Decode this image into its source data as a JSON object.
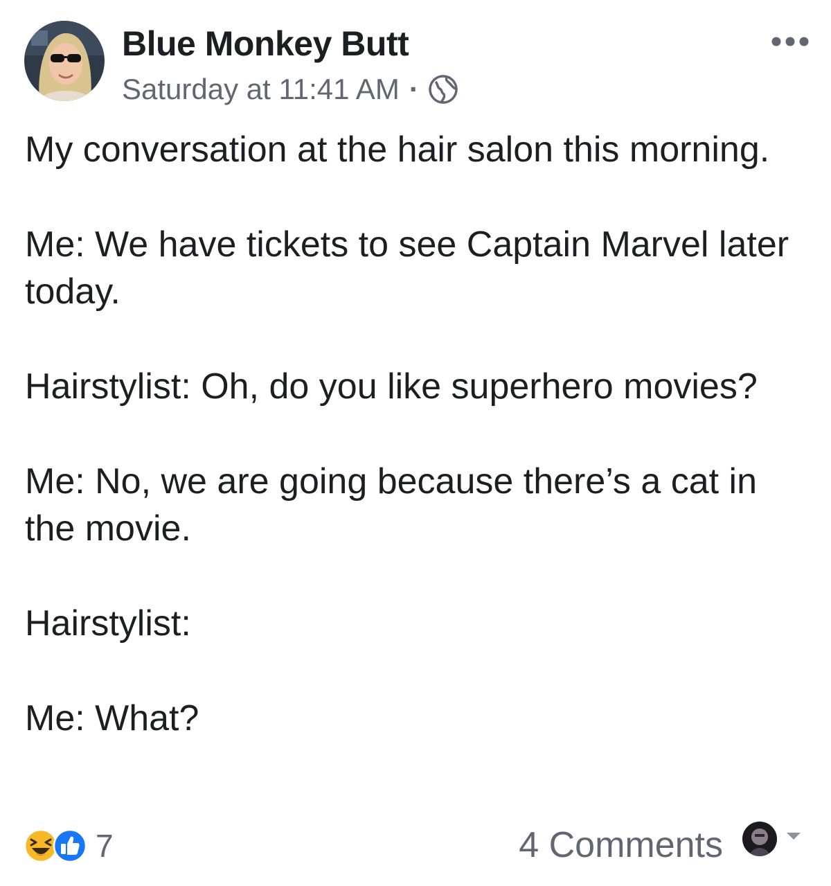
{
  "post": {
    "author": "Blue Monkey Butt",
    "timestamp": "Saturday at 11:41 AM",
    "separator": "·",
    "privacy_icon": "globe-icon",
    "more_icon": "more-horizontal-icon",
    "paragraphs": [
      "My conversation at the hair salon this morning.",
      "Me: We have tickets to see Captain Marvel later today.",
      "Hairstylist: Oh, do you like superhero movies?",
      "Me:  No, we are going because there’s a cat in the movie.",
      "Hairstylist:",
      "Me:  What?"
    ]
  },
  "footer": {
    "reaction_icons": [
      "haha-reaction-icon",
      "like-reaction-icon"
    ],
    "reaction_count": "7",
    "comments_label": "4 Comments",
    "dropdown_icon": "caret-down-icon"
  },
  "colors": {
    "text_primary": "#1c1e21",
    "text_secondary": "#616770",
    "like_blue": "#1877f2",
    "haha_yellow": "#f7b928"
  }
}
